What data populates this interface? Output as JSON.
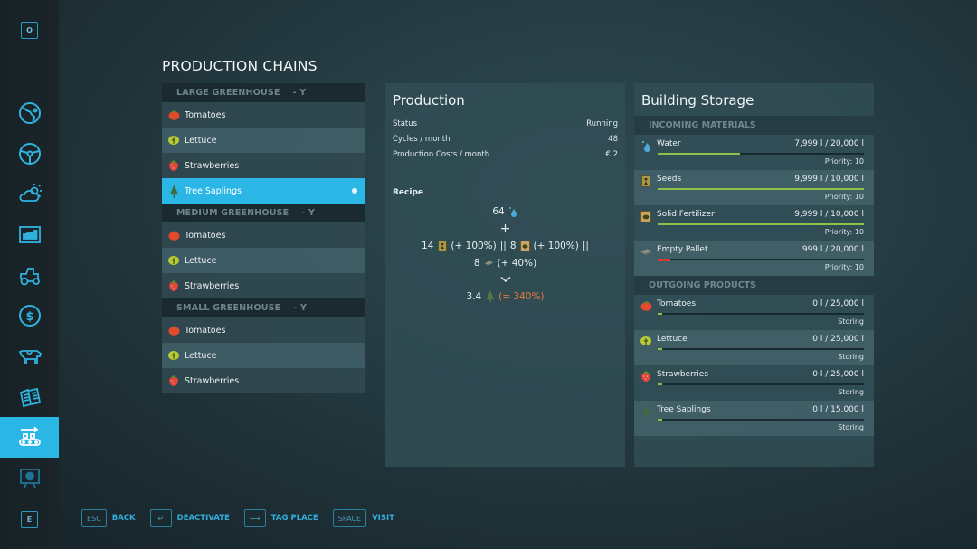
{
  "sidebar": {
    "top_key": "Q",
    "bottom_key": "E",
    "items": [
      {
        "icon": "map-globe-icon",
        "active": false
      },
      {
        "icon": "steering-wheel-icon",
        "active": false
      },
      {
        "icon": "weather-icon",
        "active": false
      },
      {
        "icon": "statistics-icon",
        "active": false
      },
      {
        "icon": "vehicles-icon",
        "active": false
      },
      {
        "icon": "finances-icon",
        "active": false
      },
      {
        "icon": "animals-icon",
        "active": false
      },
      {
        "icon": "contracts-icon",
        "active": false
      },
      {
        "icon": "production-icon",
        "active": true
      },
      {
        "icon": "tutorial-board-icon",
        "active": false
      }
    ]
  },
  "page_title": "PRODUCTION CHAINS",
  "chains": [
    {
      "header": "LARGE GREENHOUSE",
      "suffix": "- Y",
      "items": [
        {
          "label": "Tomatoes",
          "icon": "tomato-icon"
        },
        {
          "label": "Lettuce",
          "icon": "lettuce-icon"
        },
        {
          "label": "Strawberries",
          "icon": "strawberry-icon"
        },
        {
          "label": "Tree Saplings",
          "icon": "tree-sapling-icon",
          "selected": true,
          "active_dot": true
        }
      ]
    },
    {
      "header": "MEDIUM GREENHOUSE",
      "suffix": "- Y",
      "items": [
        {
          "label": "Tomatoes",
          "icon": "tomato-icon"
        },
        {
          "label": "Lettuce",
          "icon": "lettuce-icon"
        },
        {
          "label": "Strawberries",
          "icon": "strawberry-icon"
        }
      ]
    },
    {
      "header": "SMALL GREENHOUSE",
      "suffix": "- Y",
      "items": [
        {
          "label": "Tomatoes",
          "icon": "tomato-icon"
        },
        {
          "label": "Lettuce",
          "icon": "lettuce-icon"
        },
        {
          "label": "Strawberries",
          "icon": "strawberry-icon"
        }
      ]
    }
  ],
  "production": {
    "title": "Production",
    "rows": [
      {
        "label": "Status",
        "value": "Running"
      },
      {
        "label": "Cycles / month",
        "value": "48"
      },
      {
        "label": "Production Costs / month",
        "value": "€ 2"
      }
    ],
    "recipe_label": "Recipe",
    "recipe": {
      "water_amount": "64",
      "plus": "+",
      "seeds_amount": "14",
      "seeds_boost": "(+ 100%)",
      "sep1": "||",
      "fert_amount": "8",
      "fert_boost": "(+ 100%)",
      "sep2": "||",
      "pallet_amount": "8",
      "pallet_boost": "(+ 40%)",
      "arrow": "⌄",
      "output_amount": "3.4",
      "output_pct": "(= 340%)"
    }
  },
  "storage": {
    "title": "Building Storage",
    "incoming_header": "INCOMING MATERIALS",
    "incoming": [
      {
        "name": "Water",
        "icon": "water-drop-icon",
        "amount": "7,999 l / 20,000 l",
        "fill": 0.4,
        "sub": "Priority: 10"
      },
      {
        "name": "Seeds",
        "icon": "seeds-bag-icon",
        "amount": "9,999 l / 10,000 l",
        "fill": 1.0,
        "sub": "Priority: 10"
      },
      {
        "name": "Solid Fertilizer",
        "icon": "fertilizer-bag-icon",
        "amount": "9,999 l / 10,000 l",
        "fill": 1.0,
        "sub": "Priority: 10"
      },
      {
        "name": "Empty Pallet",
        "icon": "pallet-icon",
        "amount": "999 l / 20,000 l",
        "fill": 0.05,
        "low": true,
        "sub": "Priority: 10"
      }
    ],
    "outgoing_header": "OUTGOING PRODUCTS",
    "outgoing": [
      {
        "name": "Tomatoes",
        "icon": "tomato-icon",
        "amount": "0 l / 25,000 l",
        "fill": 0.0,
        "sub": "Storing"
      },
      {
        "name": "Lettuce",
        "icon": "lettuce-icon",
        "amount": "0 l / 25,000 l",
        "fill": 0.0,
        "sub": "Storing"
      },
      {
        "name": "Strawberries",
        "icon": "strawberry-icon",
        "amount": "0 l / 25,000 l",
        "fill": 0.0,
        "sub": "Storing"
      },
      {
        "name": "Tree Saplings",
        "icon": "tree-sapling-icon",
        "amount": "0 l / 15,000 l",
        "fill": 0.0,
        "sub": "Storing"
      }
    ]
  },
  "footer": [
    {
      "key": "ESC",
      "label": "BACK"
    },
    {
      "key": "↵",
      "label": "DEACTIVATE"
    },
    {
      "key": "⟷",
      "label": "TAG PLACE"
    },
    {
      "key": "SPACE",
      "label": "VISIT"
    }
  ],
  "colors": {
    "accent": "#2bb7e6",
    "bar_fill": "#8bc34a",
    "bar_low": "#d6373a",
    "output_pct": "#e8793c"
  }
}
